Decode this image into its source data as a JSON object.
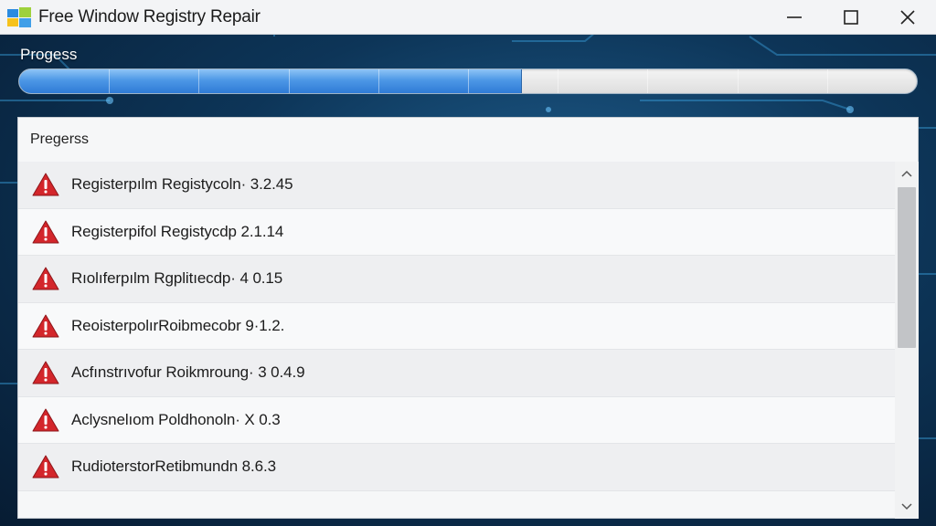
{
  "window": {
    "title": "Free Window Registry Repair",
    "controls": [
      "minimize-icon",
      "maximize-icon",
      "close-icon"
    ]
  },
  "progress": {
    "label": "Progess",
    "fraction": 0.56,
    "fill_color": "#4d98e6"
  },
  "panel": {
    "header": "Pregerss",
    "items": [
      {
        "text": "Registerpılm Registycoln· 3.2.45",
        "icon": "warning-icon"
      },
      {
        "text": "Registerpifol Registycdp 2.1.14",
        "icon": "warning-icon"
      },
      {
        "text": "Rıolıferpılm Rgplitıecdp· 4 0.15",
        "icon": "warning-icon"
      },
      {
        "text": "ReoisterpolırRoibmecobr 9·1.2.",
        "icon": "warning-icon"
      },
      {
        "text": "Acfınstrıvofur Roikmroung· 3 0.4.9",
        "icon": "warning-icon"
      },
      {
        "text": "Aclysnelıom Poldhonoln· X 0.3",
        "icon": "warning-icon"
      },
      {
        "text": "RudioterstorRetibmundn 8.6.3",
        "icon": "warning-icon"
      }
    ]
  },
  "colors": {
    "warning_red": "#d3262b",
    "titlebar_bg": "#f3f4f6"
  }
}
